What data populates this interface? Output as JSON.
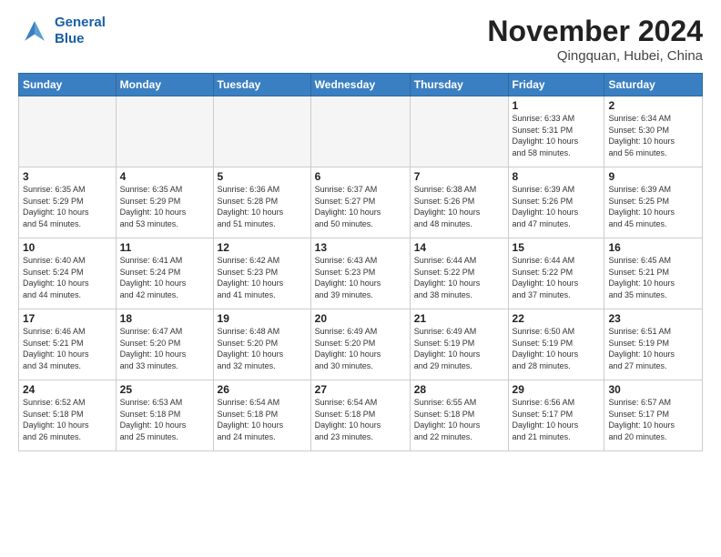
{
  "header": {
    "logo_line1": "General",
    "logo_line2": "Blue",
    "month_title": "November 2024",
    "location": "Qingquan, Hubei, China"
  },
  "weekdays": [
    "Sunday",
    "Monday",
    "Tuesday",
    "Wednesday",
    "Thursday",
    "Friday",
    "Saturday"
  ],
  "weeks": [
    [
      {
        "day": "",
        "info": "",
        "empty": true
      },
      {
        "day": "",
        "info": "",
        "empty": true
      },
      {
        "day": "",
        "info": "",
        "empty": true
      },
      {
        "day": "",
        "info": "",
        "empty": true
      },
      {
        "day": "",
        "info": "",
        "empty": true
      },
      {
        "day": "1",
        "info": "Sunrise: 6:33 AM\nSunset: 5:31 PM\nDaylight: 10 hours\nand 58 minutes."
      },
      {
        "day": "2",
        "info": "Sunrise: 6:34 AM\nSunset: 5:30 PM\nDaylight: 10 hours\nand 56 minutes."
      }
    ],
    [
      {
        "day": "3",
        "info": "Sunrise: 6:35 AM\nSunset: 5:29 PM\nDaylight: 10 hours\nand 54 minutes."
      },
      {
        "day": "4",
        "info": "Sunrise: 6:35 AM\nSunset: 5:29 PM\nDaylight: 10 hours\nand 53 minutes."
      },
      {
        "day": "5",
        "info": "Sunrise: 6:36 AM\nSunset: 5:28 PM\nDaylight: 10 hours\nand 51 minutes."
      },
      {
        "day": "6",
        "info": "Sunrise: 6:37 AM\nSunset: 5:27 PM\nDaylight: 10 hours\nand 50 minutes."
      },
      {
        "day": "7",
        "info": "Sunrise: 6:38 AM\nSunset: 5:26 PM\nDaylight: 10 hours\nand 48 minutes."
      },
      {
        "day": "8",
        "info": "Sunrise: 6:39 AM\nSunset: 5:26 PM\nDaylight: 10 hours\nand 47 minutes."
      },
      {
        "day": "9",
        "info": "Sunrise: 6:39 AM\nSunset: 5:25 PM\nDaylight: 10 hours\nand 45 minutes."
      }
    ],
    [
      {
        "day": "10",
        "info": "Sunrise: 6:40 AM\nSunset: 5:24 PM\nDaylight: 10 hours\nand 44 minutes."
      },
      {
        "day": "11",
        "info": "Sunrise: 6:41 AM\nSunset: 5:24 PM\nDaylight: 10 hours\nand 42 minutes."
      },
      {
        "day": "12",
        "info": "Sunrise: 6:42 AM\nSunset: 5:23 PM\nDaylight: 10 hours\nand 41 minutes."
      },
      {
        "day": "13",
        "info": "Sunrise: 6:43 AM\nSunset: 5:23 PM\nDaylight: 10 hours\nand 39 minutes."
      },
      {
        "day": "14",
        "info": "Sunrise: 6:44 AM\nSunset: 5:22 PM\nDaylight: 10 hours\nand 38 minutes."
      },
      {
        "day": "15",
        "info": "Sunrise: 6:44 AM\nSunset: 5:22 PM\nDaylight: 10 hours\nand 37 minutes."
      },
      {
        "day": "16",
        "info": "Sunrise: 6:45 AM\nSunset: 5:21 PM\nDaylight: 10 hours\nand 35 minutes."
      }
    ],
    [
      {
        "day": "17",
        "info": "Sunrise: 6:46 AM\nSunset: 5:21 PM\nDaylight: 10 hours\nand 34 minutes."
      },
      {
        "day": "18",
        "info": "Sunrise: 6:47 AM\nSunset: 5:20 PM\nDaylight: 10 hours\nand 33 minutes."
      },
      {
        "day": "19",
        "info": "Sunrise: 6:48 AM\nSunset: 5:20 PM\nDaylight: 10 hours\nand 32 minutes."
      },
      {
        "day": "20",
        "info": "Sunrise: 6:49 AM\nSunset: 5:20 PM\nDaylight: 10 hours\nand 30 minutes."
      },
      {
        "day": "21",
        "info": "Sunrise: 6:49 AM\nSunset: 5:19 PM\nDaylight: 10 hours\nand 29 minutes."
      },
      {
        "day": "22",
        "info": "Sunrise: 6:50 AM\nSunset: 5:19 PM\nDaylight: 10 hours\nand 28 minutes."
      },
      {
        "day": "23",
        "info": "Sunrise: 6:51 AM\nSunset: 5:19 PM\nDaylight: 10 hours\nand 27 minutes."
      }
    ],
    [
      {
        "day": "24",
        "info": "Sunrise: 6:52 AM\nSunset: 5:18 PM\nDaylight: 10 hours\nand 26 minutes."
      },
      {
        "day": "25",
        "info": "Sunrise: 6:53 AM\nSunset: 5:18 PM\nDaylight: 10 hours\nand 25 minutes."
      },
      {
        "day": "26",
        "info": "Sunrise: 6:54 AM\nSunset: 5:18 PM\nDaylight: 10 hours\nand 24 minutes."
      },
      {
        "day": "27",
        "info": "Sunrise: 6:54 AM\nSunset: 5:18 PM\nDaylight: 10 hours\nand 23 minutes."
      },
      {
        "day": "28",
        "info": "Sunrise: 6:55 AM\nSunset: 5:18 PM\nDaylight: 10 hours\nand 22 minutes."
      },
      {
        "day": "29",
        "info": "Sunrise: 6:56 AM\nSunset: 5:17 PM\nDaylight: 10 hours\nand 21 minutes."
      },
      {
        "day": "30",
        "info": "Sunrise: 6:57 AM\nSunset: 5:17 PM\nDaylight: 10 hours\nand 20 minutes."
      }
    ]
  ]
}
